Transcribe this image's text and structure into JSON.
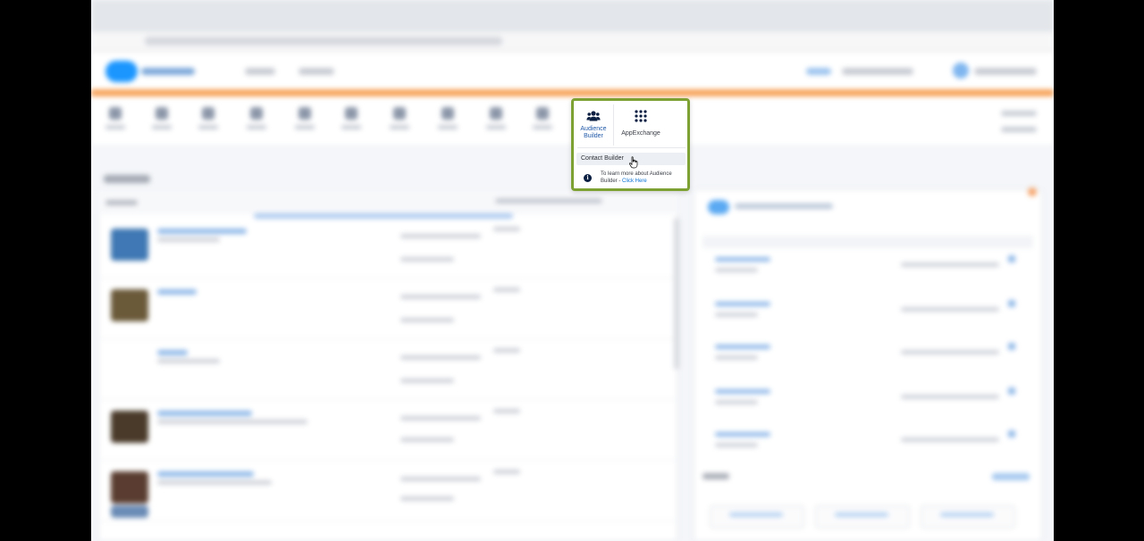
{
  "popup": {
    "tiles": [
      {
        "label_line1": "Audience",
        "label_line2": "Builder",
        "icon": "users-group-icon"
      },
      {
        "label": "AppExchange",
        "icon": "app-grid-icon"
      }
    ],
    "menu_item": "Contact Builder",
    "info": {
      "icon": "info-icon",
      "text": "To learn more about Audience Builder - ",
      "link": "Click Here"
    }
  },
  "colors": {
    "popup_border": "#7ea134",
    "header_accent": "#f7a35a",
    "link": "#0b72d4",
    "brand": "#1b96ff"
  }
}
